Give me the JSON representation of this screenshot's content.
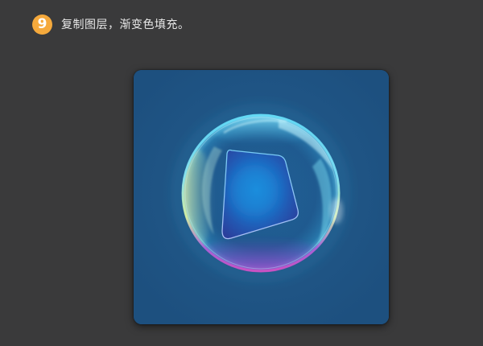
{
  "step": {
    "number": "9",
    "text": "复制图层，渐变色填充。"
  },
  "colors": {
    "page_background": "#3a3a3b",
    "step_badge": "#f5a93c",
    "canvas_background": "#1e5282",
    "square_center": "#1a7bd0",
    "square_edge": "#2a3f9a"
  },
  "artwork": {
    "name": "glass-bubble-icon"
  }
}
